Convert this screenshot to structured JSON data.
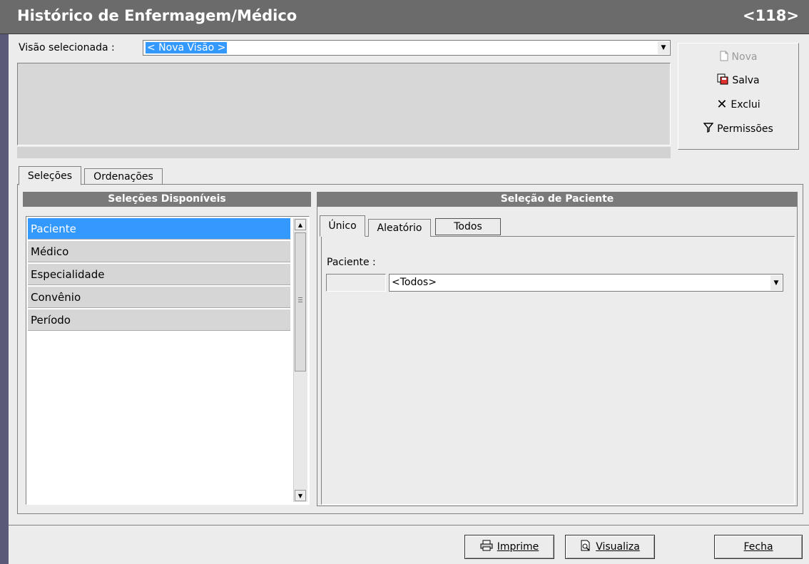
{
  "window": {
    "title": "Histórico de Enfermagem/Médico",
    "code": "<118>"
  },
  "vision": {
    "label": "Visão selecionada  :",
    "value": "< Nova Visão >"
  },
  "side_buttons": {
    "nova": "Nova",
    "salva": "Salva",
    "exclui": "Exclui",
    "permissoes": "Permissões"
  },
  "main_tabs": {
    "selecoes": "Seleções",
    "ordenacoes": "Ordenações"
  },
  "available": {
    "header": "Seleções Disponíveis",
    "items": [
      "Paciente",
      "Médico",
      "Especialidade",
      "Convênio",
      "Período"
    ],
    "selected": "Paciente"
  },
  "patient": {
    "header": "Seleção de Paciente",
    "tabs": {
      "unico": "Único",
      "aleatorio": "Aleatório",
      "todos": "Todos"
    },
    "field_label": "Paciente :",
    "field_value": "<Todos>"
  },
  "footer": {
    "imprime": "Imprime",
    "visualiza": "Visualiza",
    "fecha": "Fecha"
  },
  "icons": [
    "new-document-icon",
    "save-icon",
    "delete-x-icon",
    "filter-funnel-icon",
    "printer-icon",
    "preview-icon"
  ]
}
